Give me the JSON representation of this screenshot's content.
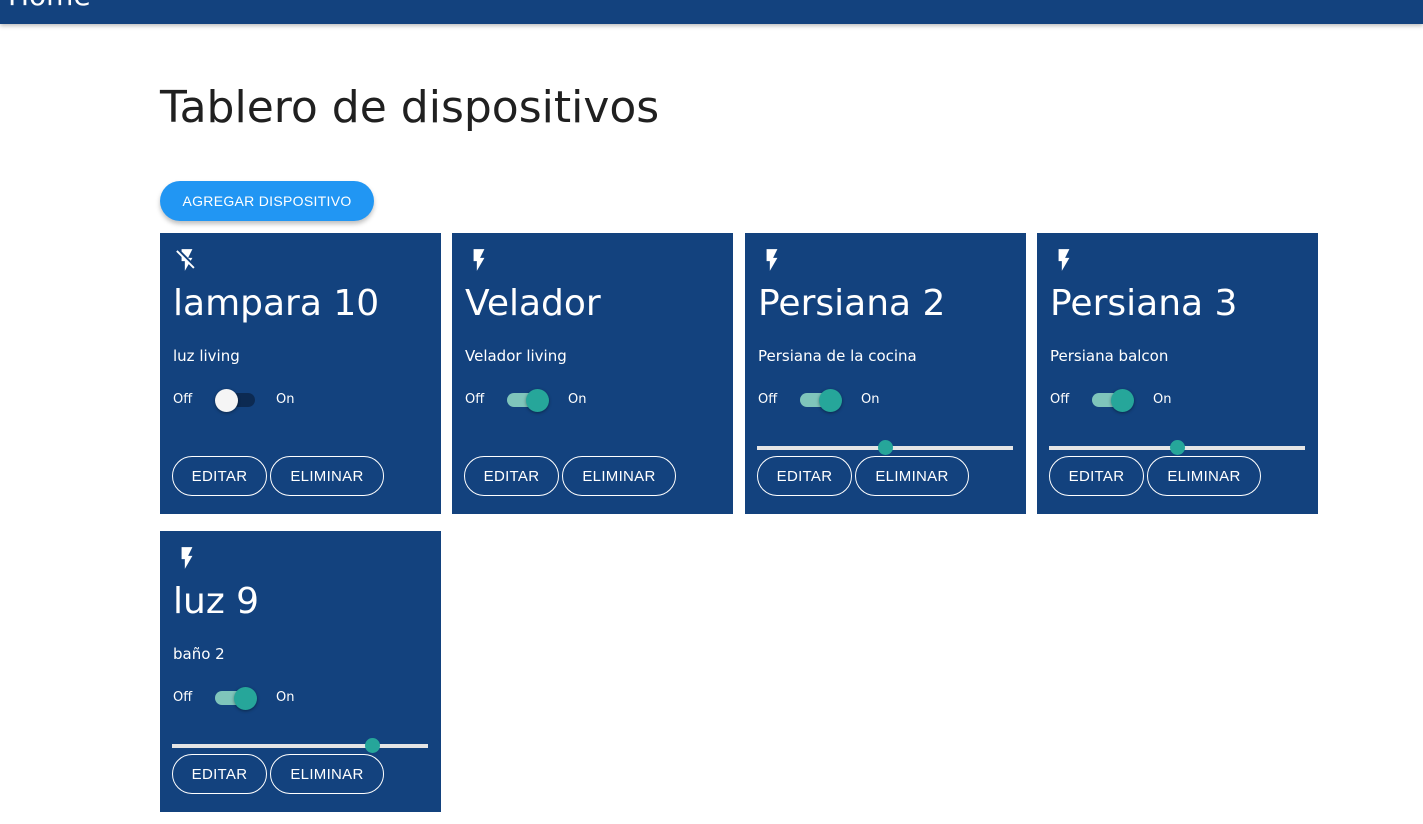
{
  "header": {
    "title": "Home"
  },
  "page": {
    "title": "Tablero de dispositivos",
    "add_button": "AGREGAR DISPOSITIVO"
  },
  "labels": {
    "off": "Off",
    "on": "On",
    "edit": "EDITAR",
    "delete": "ELIMINAR"
  },
  "colors": {
    "bar": "#13427e",
    "card": "#13427e",
    "accent": "#26a69a",
    "add_button": "#2196f3"
  },
  "devices": [
    {
      "name": "lampara 10",
      "description": "luz living",
      "icon": "flash-off-icon",
      "state": "off",
      "has_slider": false
    },
    {
      "name": "Velador",
      "description": "Velador living",
      "icon": "flash-icon",
      "state": "on",
      "has_slider": false
    },
    {
      "name": "Persiana 2",
      "description": "Persiana de la cocina",
      "icon": "flash-icon",
      "state": "on",
      "has_slider": true,
      "slider_value": 0.5
    },
    {
      "name": "Persiana 3",
      "description": "Persiana balcon",
      "icon": "flash-icon",
      "state": "on",
      "has_slider": true,
      "slider_value": 0.5
    },
    {
      "name": "luz 9",
      "description": "baño 2",
      "icon": "flash-icon",
      "state": "on",
      "has_slider": true,
      "slider_value": 0.78
    }
  ]
}
